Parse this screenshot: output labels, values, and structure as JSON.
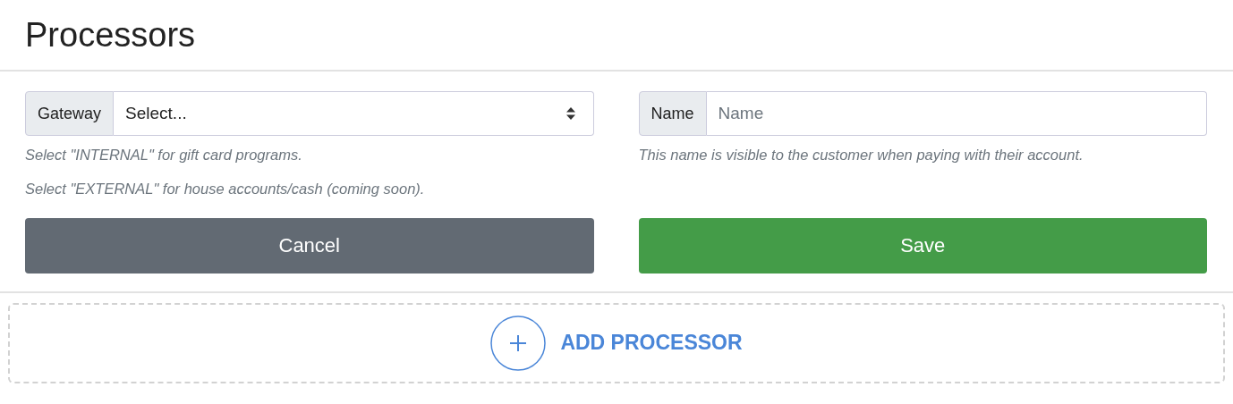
{
  "page": {
    "title": "Processors"
  },
  "gateway": {
    "label": "Gateway",
    "value": "Select...",
    "hints": [
      "Select \"INTERNAL\" for gift card programs.",
      "Select \"EXTERNAL\" for house accounts/cash (coming soon)."
    ]
  },
  "name": {
    "label": "Name",
    "placeholder": "Name",
    "hint": "This name is visible to the customer when paying with their account."
  },
  "buttons": [
    {
      "label": "Cancel",
      "kind": "secondary"
    },
    {
      "label": "Save",
      "kind": "primary"
    }
  ],
  "add_button": {
    "label": "ADD PROCESSOR"
  }
}
